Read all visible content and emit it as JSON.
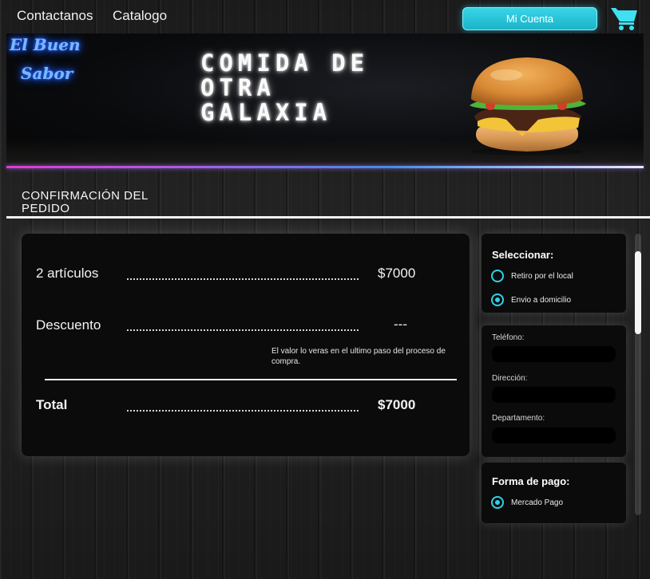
{
  "nav": {
    "contact_label": "Contactanos",
    "catalog_label": "Catalogo",
    "account_label": "Mi Cuenta"
  },
  "banner": {
    "logo_line1": "El Buen",
    "logo_line2": "Sabor",
    "headline_line1": "COMIDA DE",
    "headline_line2": "OTRA",
    "headline_line3": "GALAXIA"
  },
  "page": {
    "title_line1": "CONFIRMACIÓN DEL",
    "title_line2": "PEDIDO"
  },
  "summary": {
    "items_label": "2 artículos",
    "items_value": "$7000",
    "discount_label": "Descuento",
    "discount_value": "---",
    "discount_note": "El valor lo veras en el ultimo paso del proceso de compra.",
    "total_label": "Total",
    "total_value": "$7000"
  },
  "delivery": {
    "title": "Seleccionar:",
    "option_pickup": "Retiro por el local",
    "option_delivery": "Envio a domicilio",
    "selected": "Envio a domicilio"
  },
  "fields": {
    "phone_label": "Teléfono:",
    "phone_value": "",
    "address_label": "Dirección:",
    "address_value": "",
    "apartment_label": "Departamento:",
    "apartment_value": ""
  },
  "payment": {
    "title": "Forma de pago:",
    "option_mercadopago": "Mercado Pago",
    "selected": "Mercado Pago"
  },
  "colors": {
    "accent": "#2fd2e6",
    "neon_blue": "#2f6bff",
    "card_bg": "#0b0b0b"
  },
  "icons": {
    "cart": "shopping-cart-icon",
    "logo": "neon-logo",
    "burger": "burger-image"
  }
}
